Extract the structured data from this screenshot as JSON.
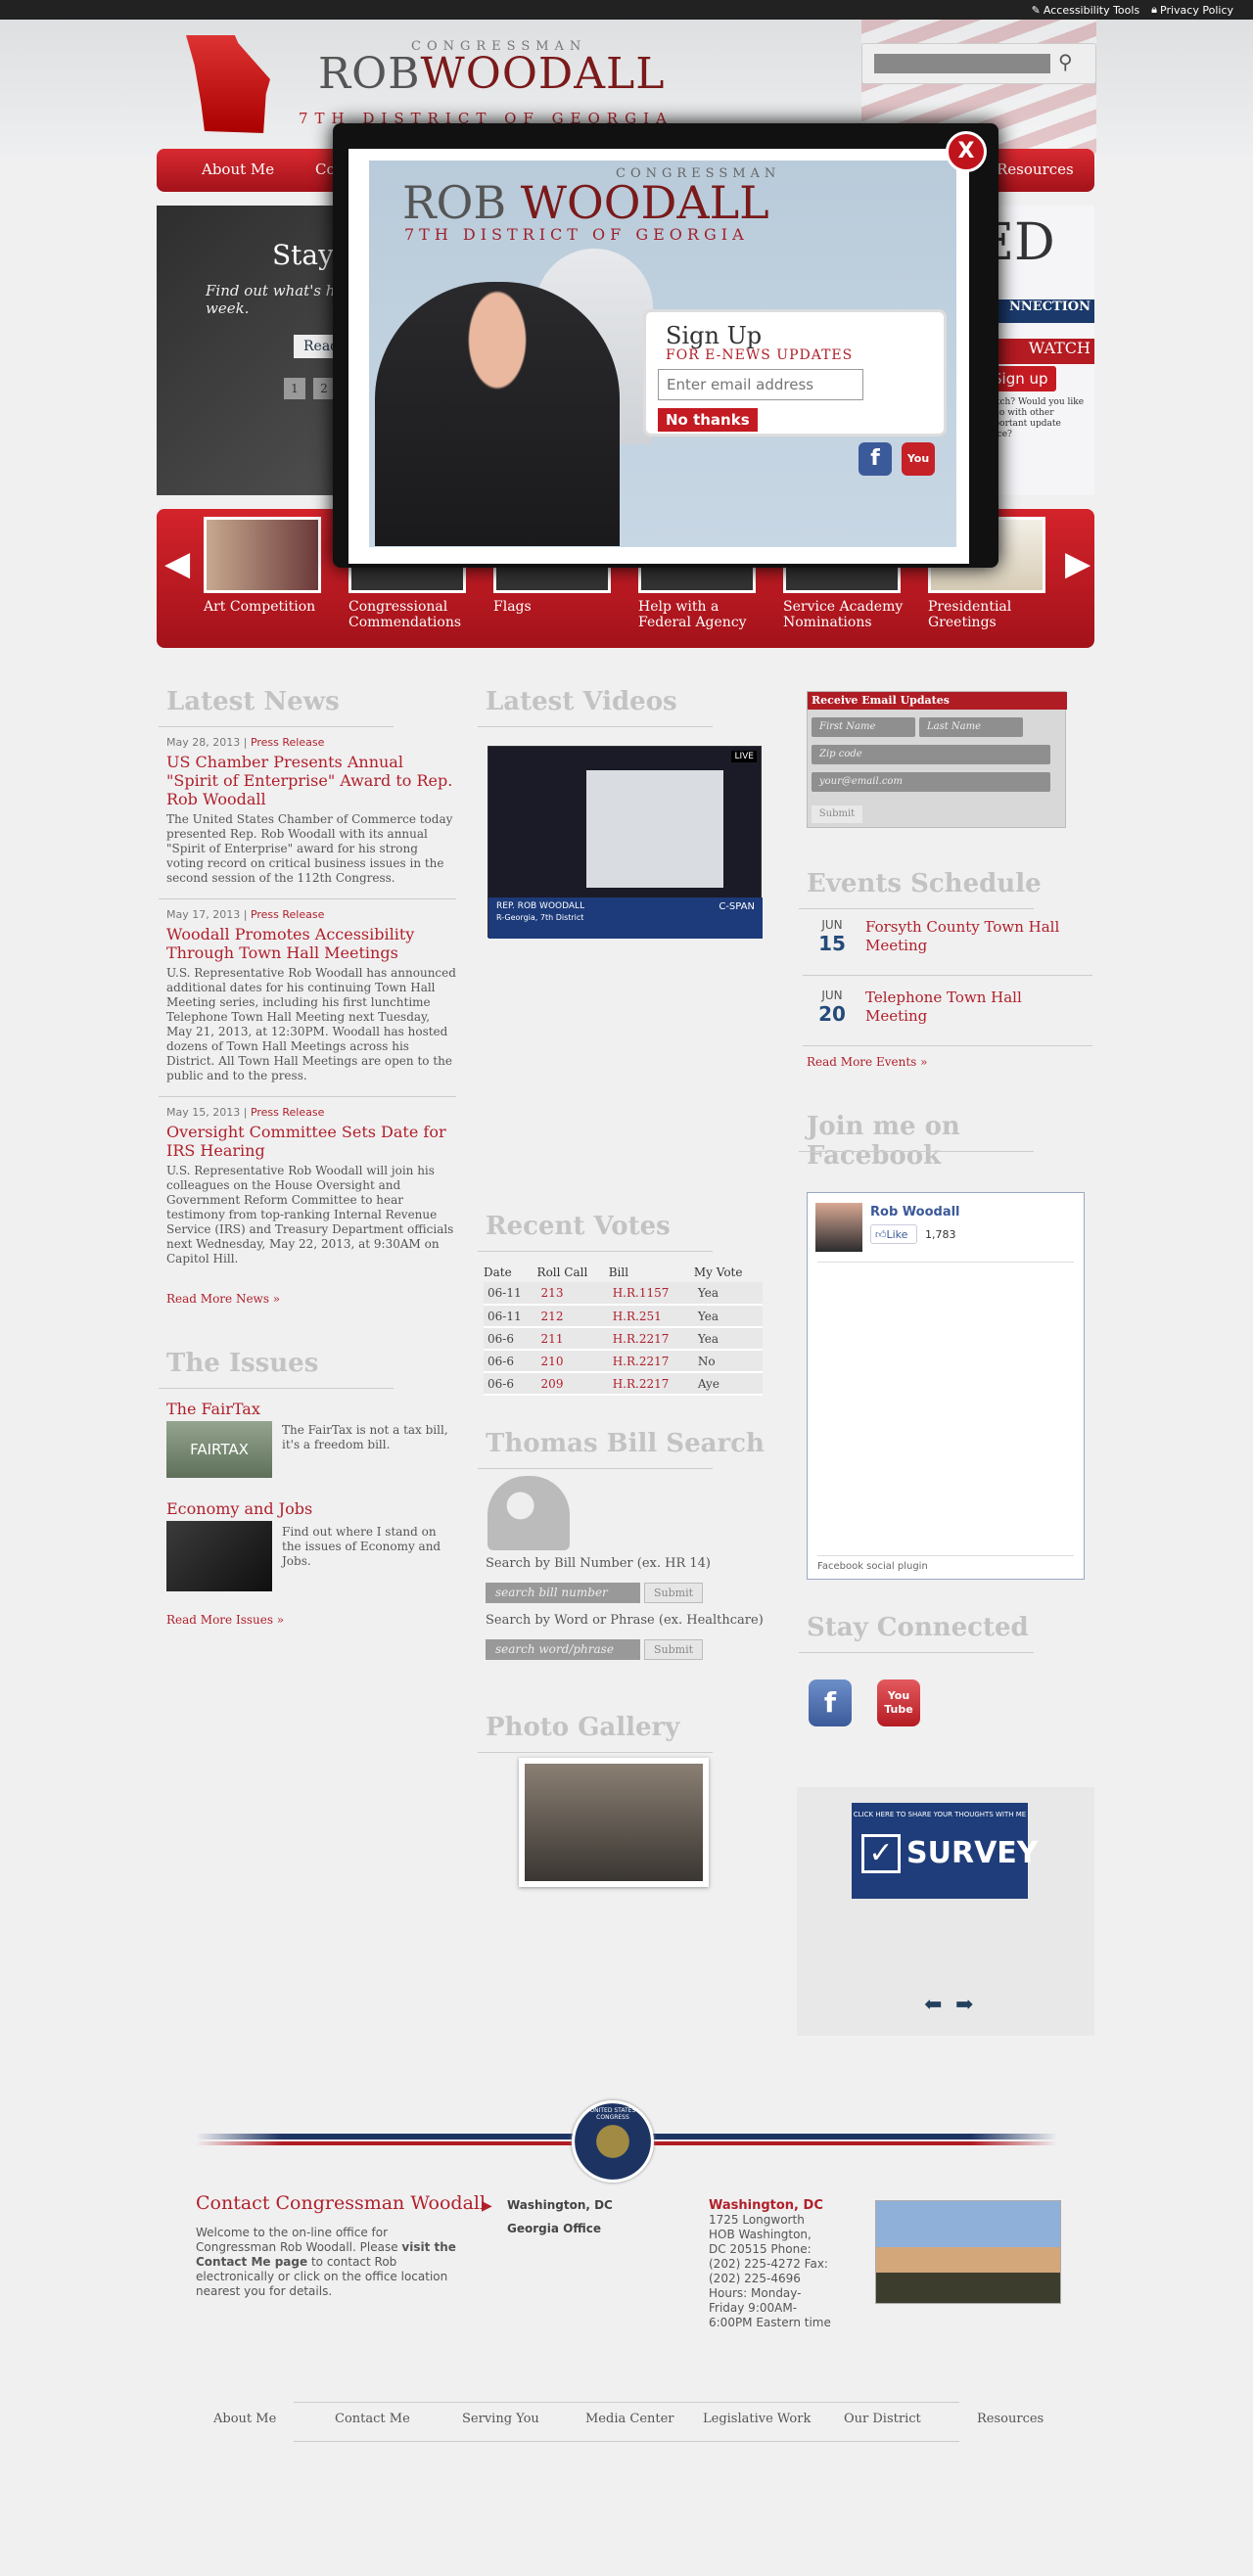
{
  "topbar": {
    "accessibility": "Accessibility Tools",
    "privacy": "Privacy Policy"
  },
  "header": {
    "congressman": "CONGRESSMAN",
    "name_first": "ROB",
    "name_last": "WOODALL",
    "district": "7TH DISTRICT OF GEORGIA"
  },
  "nav": {
    "items": [
      "About Me",
      "Co",
      "Resources"
    ]
  },
  "slider": {
    "title": "Stay I",
    "desc": "Find out what's ha each week.",
    "read": "Read",
    "pages": [
      "1",
      "2"
    ],
    "right_big": "ED",
    "right_conn": "NNECTION",
    "right_watch": "WATCH",
    "right_signup": "Sign up",
    "right_small": "Watch? Would you like to co with other important update office?"
  },
  "carousel": {
    "items": [
      "Art Competition",
      "Congressional Commendations",
      "Flags",
      "Help with a Federal Agency",
      "Service Academy Nominations",
      "Presidential Greetings"
    ]
  },
  "modal": {
    "congressman": "CONGRESSMAN",
    "name_first": "ROB",
    "name_last": "WOODALL",
    "district": "7TH DISTRICT OF GEORGIA",
    "signup_title": "Sign Up",
    "signup_sub": "FOR E-NEWS UPDATES",
    "email_placeholder": "Enter email address",
    "no_thanks": "No thanks",
    "close": "X"
  },
  "news": {
    "heading": "Latest News",
    "items": [
      {
        "date": "May 28, 2013",
        "type": "Press Release",
        "title": "US Chamber Presents Annual \"Spirit of Enterprise\" Award to Rep. Rob Woodall",
        "desc": "The United States Chamber of Commerce today presented Rep. Rob Woodall with its annual \"Spirit of Enterprise\" award for his strong voting record on critical business issues in the second session of the 112th Congress."
      },
      {
        "date": "May 17, 2013",
        "type": "Press Release",
        "title": "Woodall Promotes Accessibility Through Town Hall Meetings",
        "desc": "U.S. Representative Rob Woodall has announced additional dates for his continuing Town Hall Meeting series, including his first lunchtime Telephone Town Hall Meeting next Tuesday, May 21, 2013, at 12:30PM. Woodall has hosted dozens of Town Hall Meetings across his District. All Town Hall Meetings are open to the public and to the press."
      },
      {
        "date": "May 15, 2013",
        "type": "Press Release",
        "title": "Oversight Committee Sets Date for IRS Hearing",
        "desc": "U.S. Representative Rob Woodall will join his colleagues on the House Oversight and Government Reform Committee to hear testimony from top-ranking Internal Revenue Service (IRS) and Treasury Department officials next Wednesday, May 22, 2013, at 9:30AM on Capitol Hill."
      }
    ],
    "more": "Read More News »"
  },
  "issues": {
    "heading": "The Issues",
    "items": [
      {
        "title": "The FairTax",
        "thumb": "FAIRTAX",
        "desc": "The FairTax is not a tax bill, it's a freedom bill."
      },
      {
        "title": "Economy and Jobs",
        "thumb": "",
        "desc": "Find out where I stand on the issues of Economy and Jobs."
      }
    ],
    "more": "Read More Issues »"
  },
  "videos": {
    "heading": "Latest Videos",
    "live": "LIVE",
    "lower": "REP. ROB WOODALL",
    "lower2": "R-Georgia, 7th District",
    "network": "C-SPAN"
  },
  "votes": {
    "heading": "Recent Votes",
    "cols": [
      "Date",
      "Roll Call",
      "Bill",
      "My Vote"
    ],
    "rows": [
      [
        "06-11",
        "213",
        "H.R.1157",
        "Yea"
      ],
      [
        "06-11",
        "212",
        "H.R.251",
        "Yea"
      ],
      [
        "06-6",
        "211",
        "H.R.2217",
        "Yea"
      ],
      [
        "06-6",
        "210",
        "H.R.2217",
        "No"
      ],
      [
        "06-6",
        "209",
        "H.R.2217",
        "Aye"
      ]
    ]
  },
  "thomas": {
    "heading": "Thomas Bill Search",
    "label1": "Search by Bill Number (ex. HR 14)",
    "ph1": "search bill number",
    "btn": "Submit",
    "label2": "Search by Word or Phrase (ex. Healthcare)",
    "ph2": "search word/phrase"
  },
  "gallery": {
    "heading": "Photo Gallery"
  },
  "email_widget": {
    "header": "Receive Email Updates",
    "first": "First Name",
    "last": "Last Name",
    "zip": "Zip code",
    "email": "your@email.com",
    "submit": "Submit"
  },
  "events": {
    "heading": "Events Schedule",
    "items": [
      {
        "month": "JUN",
        "day": "15",
        "title": "Forsyth County Town Hall Meeting"
      },
      {
        "month": "JUN",
        "day": "20",
        "title": "Telephone Town Hall Meeting"
      }
    ],
    "more": "Read More Events »"
  },
  "facebook": {
    "heading": "Join me on Facebook",
    "name": "Rob Woodall",
    "like": "Like",
    "count": "1,783",
    "plugin": "Facebook social plugin"
  },
  "connected": {
    "heading": "Stay Connected",
    "fb": "f",
    "yt": "You Tube"
  },
  "survey": {
    "small": "CLICK HERE TO SHARE YOUR THOUGHTS WITH ME",
    "big": "SURVEY",
    "check": "✓"
  },
  "footer": {
    "seal": "UNITED STATES CONGRESS",
    "contact_title": "Contact Congressman Woodall",
    "contact_desc_1": "Welcome to the on-line office for Congressman Rob Woodall. Please ",
    "contact_desc_bold": "visit the Contact Me page",
    "contact_desc_2": " to contact Rob electronically or click on the office location nearest you for details.",
    "locations": [
      "Washington, DC",
      "Georgia Office"
    ],
    "addr_city": "Washington, DC",
    "addr_lines": "1725 Longworth HOB Washington, DC 20515 Phone: (202) 225-4272 Fax: (202) 225-4696 Hours: Monday-Friday 9:00AM-6:00PM Eastern time",
    "nav": [
      "About Me",
      "Contact Me",
      "Serving You",
      "Media Center",
      "Legislative Work",
      "Our District",
      "Resources"
    ]
  },
  "colors": {
    "brand_red": "#b0202a",
    "navy": "#1d3463"
  }
}
